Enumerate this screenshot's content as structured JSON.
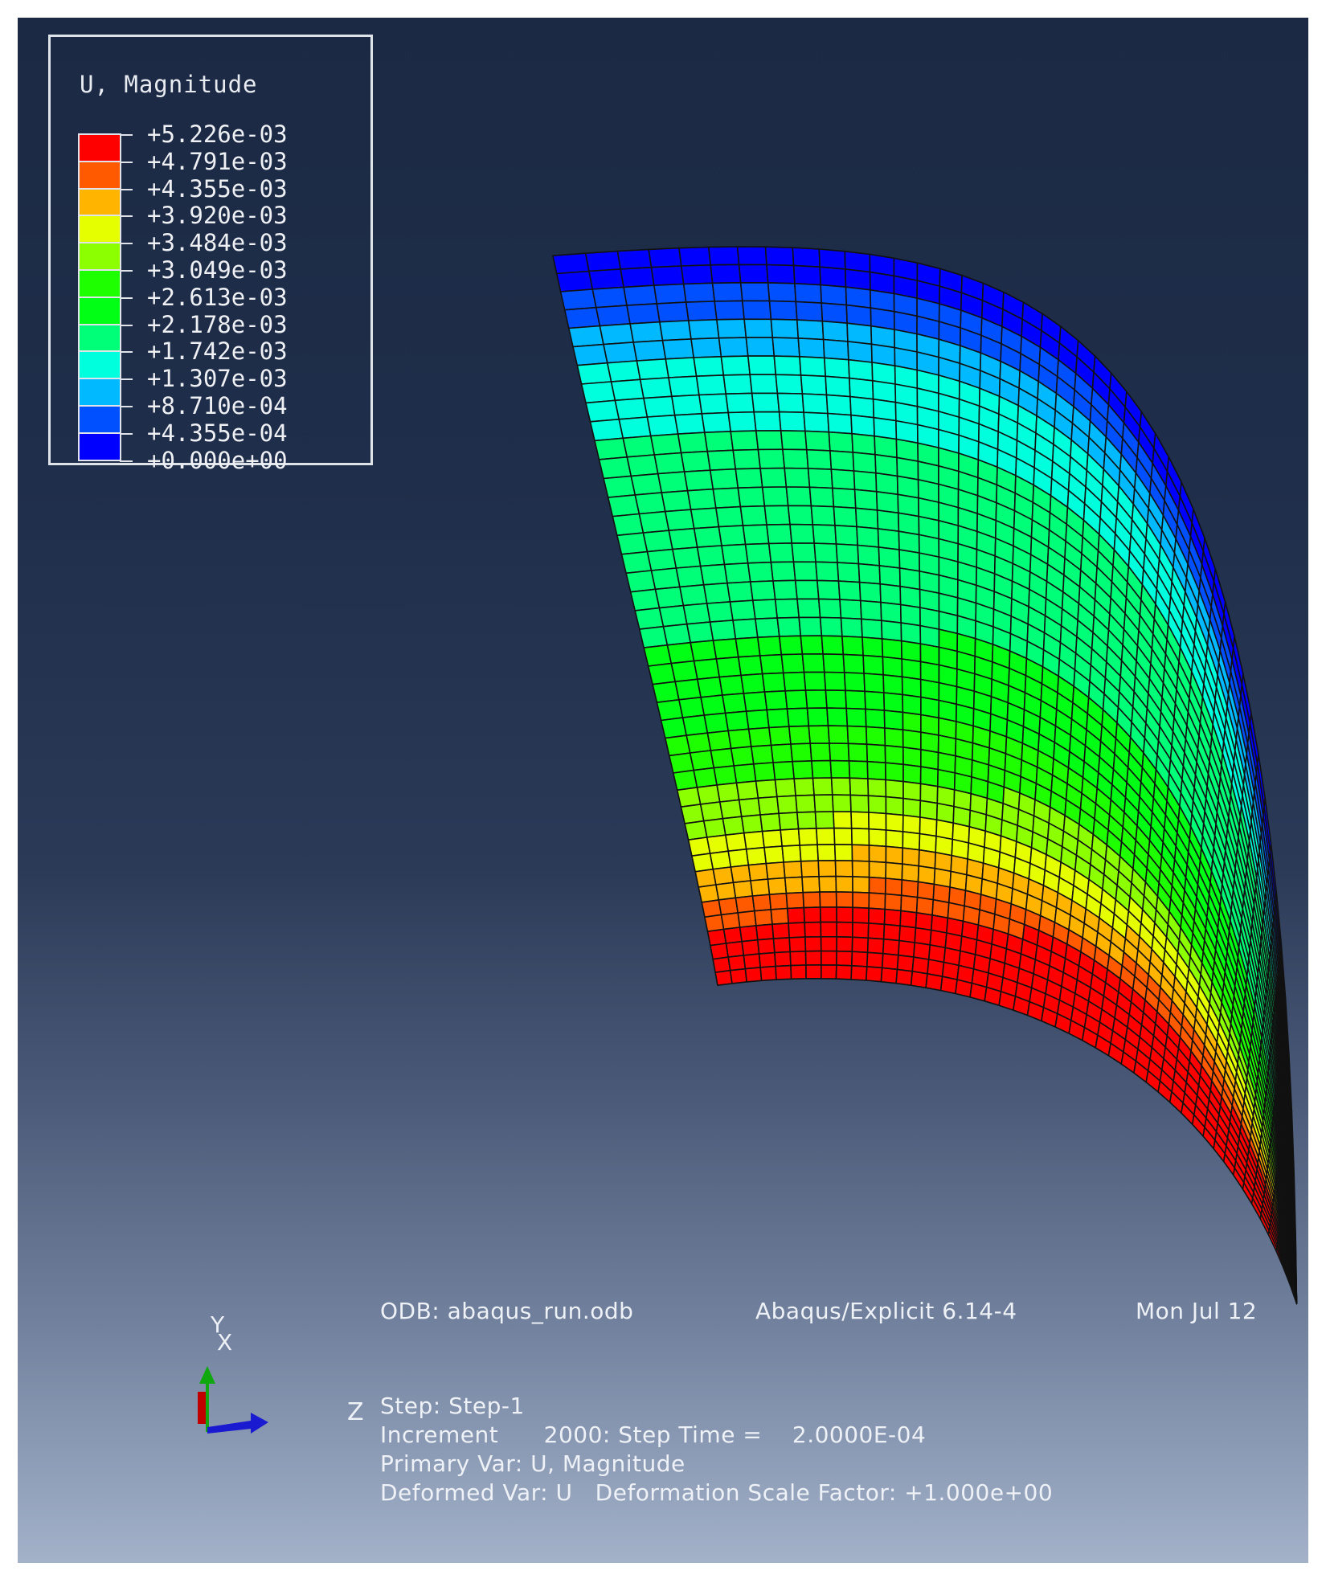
{
  "legend": {
    "title": "U, Magnitude",
    "labels": [
      "+5.226e-03",
      "+4.791e-03",
      "+4.355e-03",
      "+3.920e-03",
      "+3.484e-03",
      "+3.049e-03",
      "+2.613e-03",
      "+2.178e-03",
      "+1.742e-03",
      "+1.307e-03",
      "+8.710e-04",
      "+4.355e-04",
      "+0.000e+00"
    ],
    "colors": [
      "#ff0000",
      "#ff5a00",
      "#ffb400",
      "#e6ff00",
      "#8cff00",
      "#1eff00",
      "#00ff14",
      "#00ff78",
      "#00ffdc",
      "#00b9ff",
      "#0050ff",
      "#0000ff"
    ]
  },
  "info": {
    "odb": "ODB: abaqus_run.odb",
    "solver": "Abaqus/Explicit 6.14-4",
    "date": "Mon Jul 12",
    "step": "Step: Step-1",
    "increment": "Increment      2000: Step Time =    2.0000E-04",
    "primary_var": "Primary Var: U, Magnitude",
    "deformed_var": "Deformed Var: U   Deformation Scale Factor: +1.000e+00"
  },
  "triad": {
    "y": "Y",
    "x": "X",
    "z": "Z"
  }
}
